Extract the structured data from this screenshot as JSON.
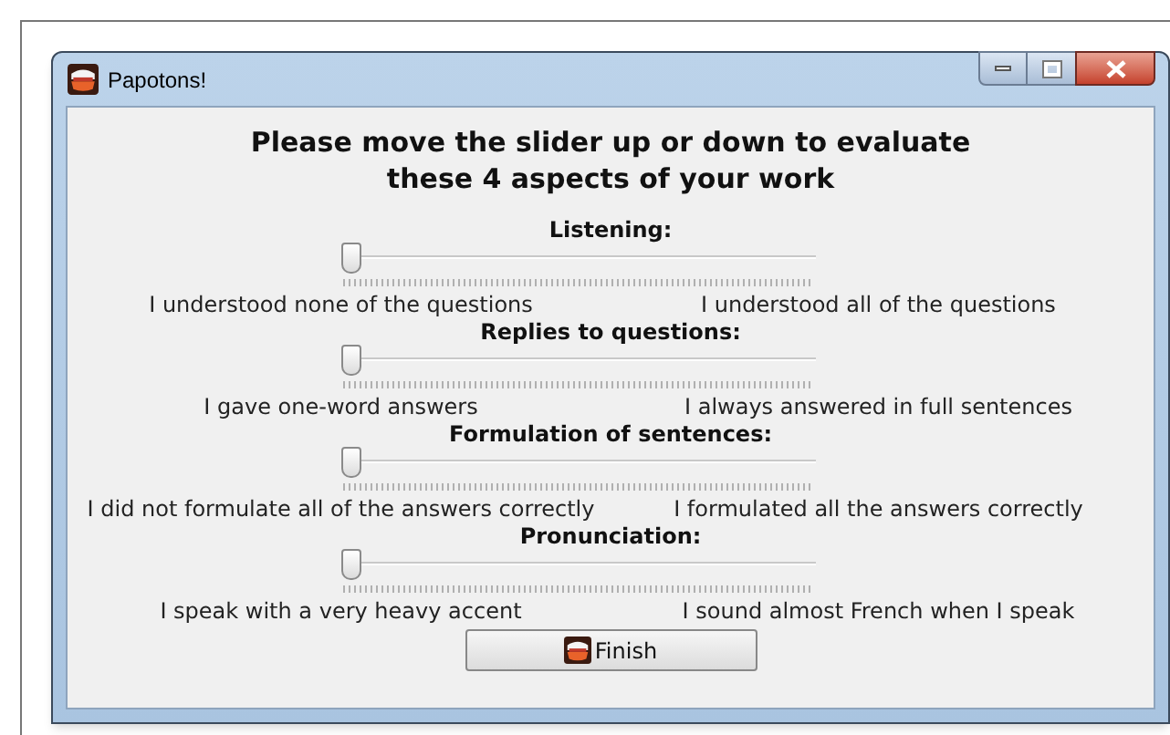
{
  "window": {
    "title": "Papotons!"
  },
  "instructions": "Please move the slider up or down to evaluate these 4 aspects of your work",
  "aspects": [
    {
      "label": "Listening:",
      "level": 0,
      "low": "I understood none of the questions",
      "high": "I understood all of the questions"
    },
    {
      "label": "Replies to questions:",
      "level": 0,
      "low": "I gave one-word answers",
      "high": "I always answered in full sentences"
    },
    {
      "label": "Formulation of sentences:",
      "level": 0,
      "low": "I did not formulate all of the answers correctly",
      "high": "I formulated all the answers correctly"
    },
    {
      "label": "Pronunciation:",
      "level": 0,
      "low": "I speak with a very heavy accent",
      "high": "I sound almost French when I speak"
    }
  ],
  "finish_button": {
    "label": "Finish"
  }
}
